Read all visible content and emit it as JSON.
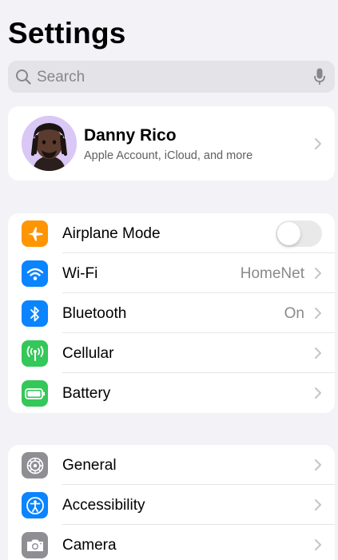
{
  "header": {
    "title": "Settings"
  },
  "search": {
    "placeholder": "Search"
  },
  "profile": {
    "name": "Danny Rico",
    "subtitle": "Apple Account, iCloud, and more"
  },
  "connectivity": [
    {
      "label": "Airplane Mode",
      "icon": "airplane-icon",
      "color": "#ff9500",
      "toggle": false
    },
    {
      "label": "Wi-Fi",
      "icon": "wifi-icon",
      "color": "#0a84ff",
      "value": "HomeNet"
    },
    {
      "label": "Bluetooth",
      "icon": "bluetooth-icon",
      "color": "#0a84ff",
      "value": "On"
    },
    {
      "label": "Cellular",
      "icon": "antenna-icon",
      "color": "#34c759"
    },
    {
      "label": "Battery",
      "icon": "battery-icon",
      "color": "#34c759"
    }
  ],
  "general": [
    {
      "label": "General",
      "icon": "gear-icon",
      "color": "#8e8e93"
    },
    {
      "label": "Accessibility",
      "icon": "accessibility-icon",
      "color": "#0a84ff"
    },
    {
      "label": "Camera",
      "icon": "camera-icon",
      "color": "#8e8e93"
    }
  ]
}
